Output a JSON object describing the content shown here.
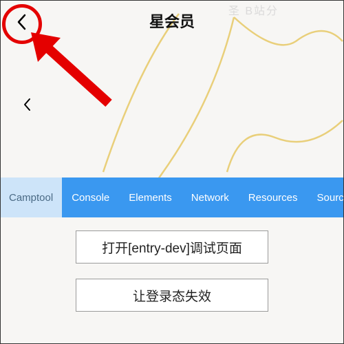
{
  "header": {
    "title": "星会员",
    "watermark": "圣   B站分   "
  },
  "tabs": [
    {
      "label": "Camptool",
      "active": true
    },
    {
      "label": "Console",
      "active": false
    },
    {
      "label": "Elements",
      "active": false
    },
    {
      "label": "Network",
      "active": false
    },
    {
      "label": "Resources",
      "active": false
    },
    {
      "label": "Source",
      "active": false
    }
  ],
  "buttons": {
    "open_debug": "打开[entry-dev]调试页面",
    "invalidate_login": "让登录态失效"
  }
}
